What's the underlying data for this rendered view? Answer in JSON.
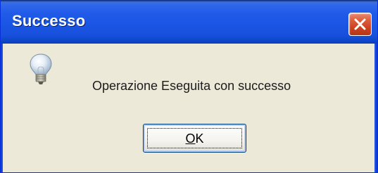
{
  "dialog": {
    "title": "Successo",
    "message": "Operazione Eseguita con successo",
    "ok_label_mnemonic": "O",
    "ok_label_rest": "K",
    "icon": "lightbulb-icon",
    "close_icon": "close-icon"
  },
  "colors": {
    "titlebar": "#1f5ae8",
    "close_button": "#dc5a3a",
    "client_background": "#ece9d8",
    "button_border": "#003c74"
  }
}
